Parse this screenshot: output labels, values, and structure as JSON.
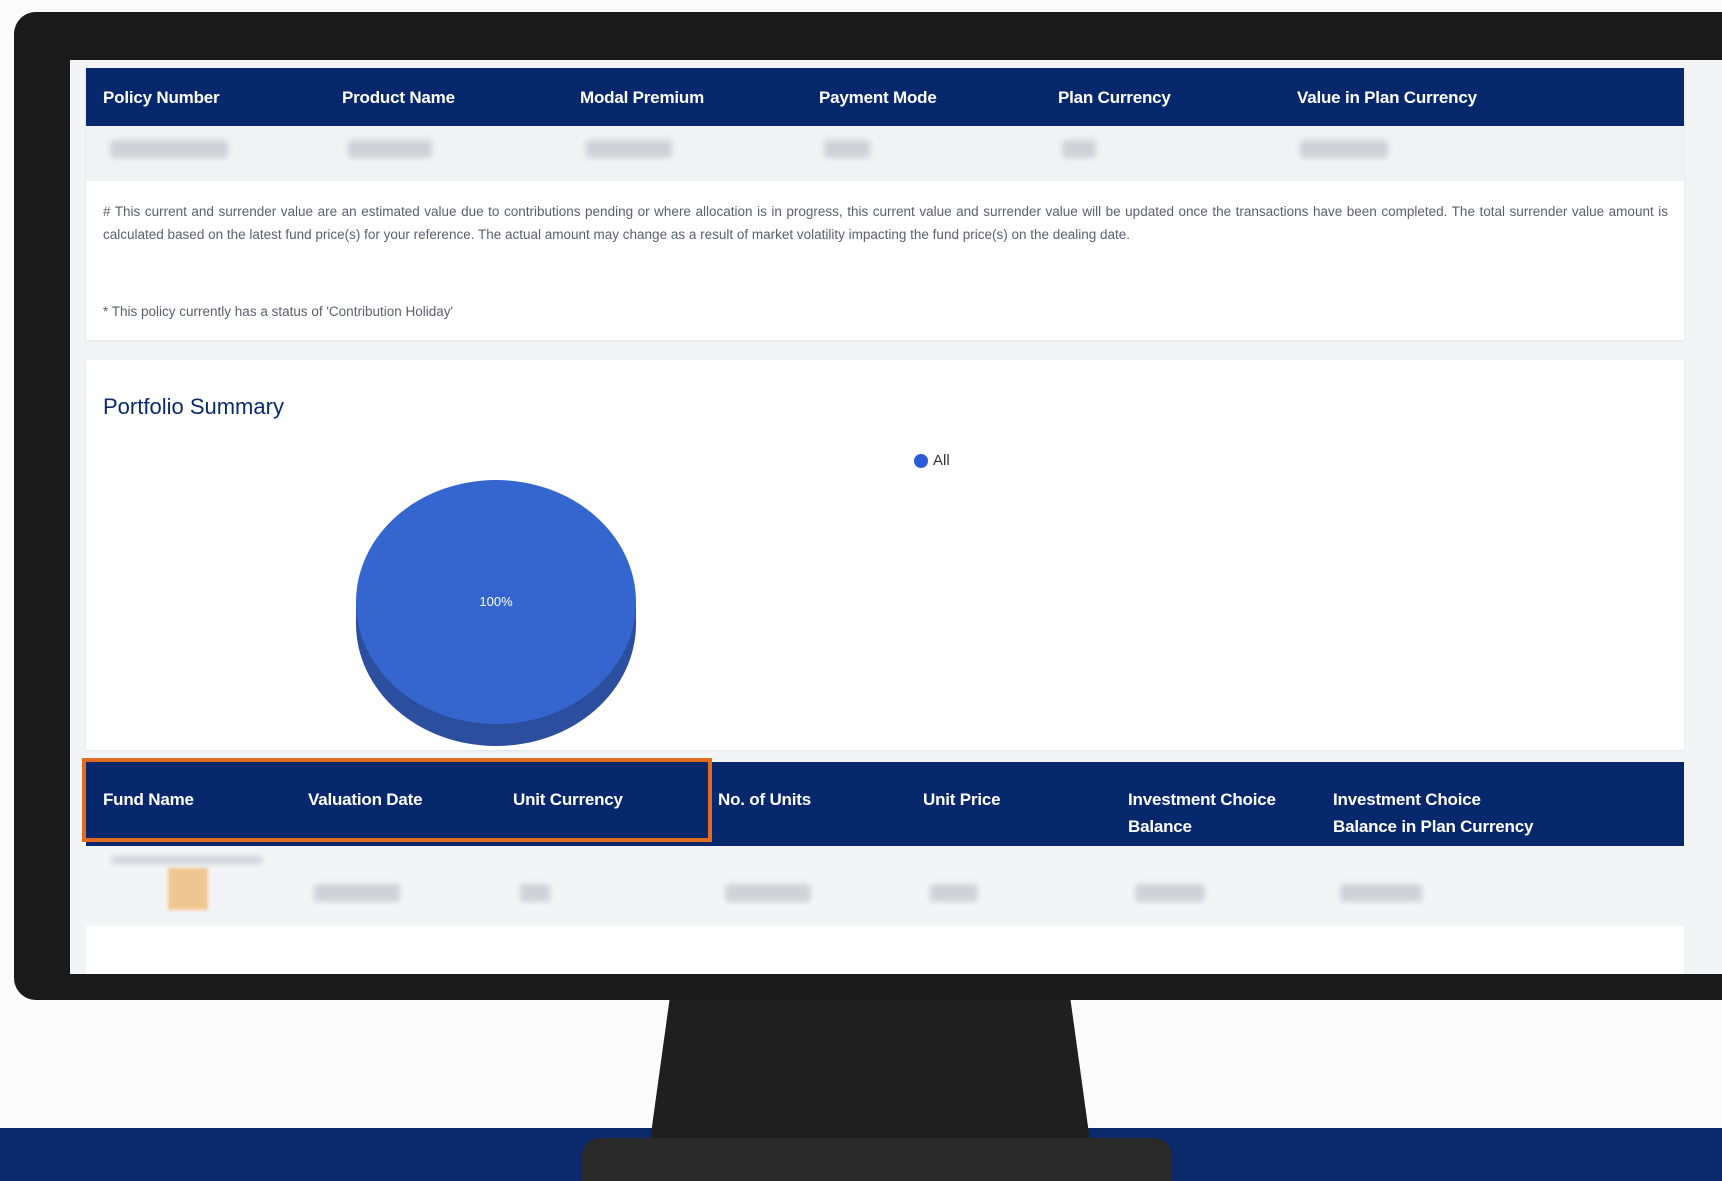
{
  "policy_table": {
    "headers": [
      "Policy Number",
      "Product Name",
      "Modal Premium",
      "Payment Mode",
      "Plan Currency",
      "Value in Plan Currency"
    ]
  },
  "notes": {
    "line1": "# This current and surrender value are an estimated value due to contributions pending or where allocation is in progress, this current value and surrender value will be updated once the transactions have been completed. The total surrender value amount is calculated based on the latest fund price(s) for your reference. The actual amount may change as a result of market volatility impacting the fund price(s) on the dealing date.",
    "line2": "* This policy currently has a status of 'Contribution Holiday'"
  },
  "portfolio": {
    "title": "Portfolio Summary",
    "legend_label": "All",
    "pie_label": "100%",
    "slice_color": "#3566d0",
    "slice_side_color": "#2b4f9e"
  },
  "chart_data": {
    "type": "pie",
    "categories": [
      "All"
    ],
    "values": [
      100
    ],
    "title": "Portfolio Summary"
  },
  "funds_table": {
    "headers": [
      {
        "line1": "Fund Name",
        "line2": ""
      },
      {
        "line1": "Valuation Date",
        "line2": ""
      },
      {
        "line1": "Unit Currency",
        "line2": ""
      },
      {
        "line1": "No. of Units",
        "line2": ""
      },
      {
        "line1": "Unit Price",
        "line2": ""
      },
      {
        "line1": "Investment Choice",
        "line2": "Balance"
      },
      {
        "line1": "Investment Choice",
        "line2": "Balance in Plan Currency"
      }
    ],
    "highlight_color": "#e36a1e"
  },
  "colors": {
    "header_navy": "#08286e",
    "band_navy": "#0a2a6b"
  }
}
